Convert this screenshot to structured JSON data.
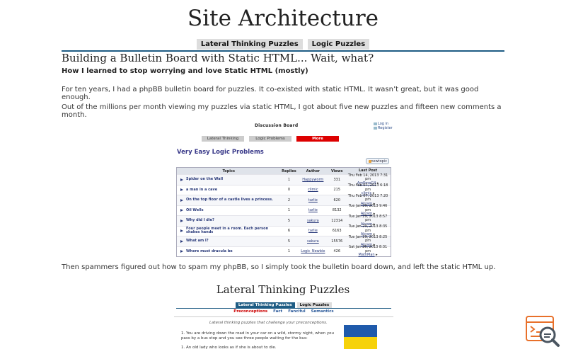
{
  "site": {
    "title": "Site Architecture",
    "nav": [
      {
        "label": "Lateral Thinking Puzzles"
      },
      {
        "label": "Logic Puzzles"
      }
    ]
  },
  "article": {
    "title": "Building a Bulletin Board with Static HTML... Wait, what?",
    "subtitle": "How I learned to stop worrying and love Static HTML (mostly)",
    "para1": "For ten years, I had a phpBB bulletin board for puzzles. It co-existed with static HTML. It wasn’t great, but it was good enough.",
    "para2": "Out of the millions per month viewing my puzzles via static HTML, I got about five new puzzles and fifteen new comments a month.",
    "para3": "Then spammers figured out how to spam my phpBB, so I simply took the bulletin board down, and left the static HTML up."
  },
  "forum": {
    "title": "Discussion Board",
    "login": "Log in",
    "register": "Register",
    "tabs": [
      {
        "label": "Lateral Thinking"
      },
      {
        "label": "Logic Problems"
      },
      {
        "label": "More"
      }
    ],
    "heading": "Very Easy Logic Problems",
    "new_topic": "newtopic",
    "columns": [
      "Topics",
      "Replies",
      "Author",
      "Views",
      "Last Post"
    ],
    "rows": [
      {
        "topic": "Spider on the Wall",
        "replies": "1",
        "author": "Happyworm",
        "views": "331",
        "last_date": "Thu Feb 14, 2013 7:31 pm",
        "last_by": "AmEmeG4"
      },
      {
        "topic": "a man in a cave",
        "replies": "0",
        "author": "climic",
        "views": "215",
        "last_date": "Thu Feb 07, 2013 6:18 pm",
        "last_by": "climic"
      },
      {
        "topic": "On the top floor of a castle lives a princess.",
        "replies": "2",
        "author": "tarlie",
        "views": "620",
        "last_date": "Thu Feb 07, 2013 7:20 pm",
        "last_by": "Akram"
      },
      {
        "topic": "Oil Wells",
        "replies": "1",
        "author": "tarlie",
        "views": "8132",
        "last_date": "Tue Jan 29, 2013 9:46 pm",
        "last_by": "Akram"
      },
      {
        "topic": "Why did I die?",
        "replies": "5",
        "author": "sakura",
        "views": "12314",
        "last_date": "Tue Jan 29, 2013 8:57 pm",
        "last_by": "Akram"
      },
      {
        "topic": "Four people meet in a room. Each person shakes hands",
        "replies": "6",
        "author": "tarlie",
        "views": "6163",
        "last_date": "Tue Jan 29, 2013 8:35 pm",
        "last_by": "Akram"
      },
      {
        "topic": "What am I?",
        "replies": "5",
        "author": "sakura",
        "views": "15576",
        "last_date": "Tue Jan 29, 2013 8:25 pm",
        "last_by": "Akram"
      },
      {
        "topic": "Where must dracula be",
        "replies": "1",
        "author": "Logic_Newbie",
        "views": "426",
        "last_date": "Sat Jan 26, 2013 8:31 pm",
        "last_by": "MathMan"
      }
    ]
  },
  "lateral": {
    "title": "Lateral Thinking Puzzles",
    "tabs": [
      {
        "label": "Lateral Thinking Puzzles"
      },
      {
        "label": "Logic Puzzles"
      }
    ],
    "subtabs": [
      {
        "label": "Preconceptions"
      },
      {
        "label": "Fact"
      },
      {
        "label": "Fanciful"
      },
      {
        "label": "Semantics"
      }
    ],
    "intro": "Lateral thinking puzzles that challenge your preconceptions.",
    "q1": "1. You are driving down the road in your car on a wild, stormy night, when you pass by a bus stop and you see three people waiting for the bus:",
    "q2": "1. An old lady who looks as if she is about to die."
  },
  "colors": {
    "accent": "#1e5c84",
    "more_tab": "#dd0000",
    "forum_link": "#2a3a7a",
    "flag_blue": "#1f5aab",
    "flag_yellow": "#f6d20a"
  },
  "icons": [
    "log-in-icon",
    "register-icon",
    "new-topic-icon",
    "topic-arrow-icon",
    "last-post-icon",
    "search-code-widget-icon"
  ]
}
